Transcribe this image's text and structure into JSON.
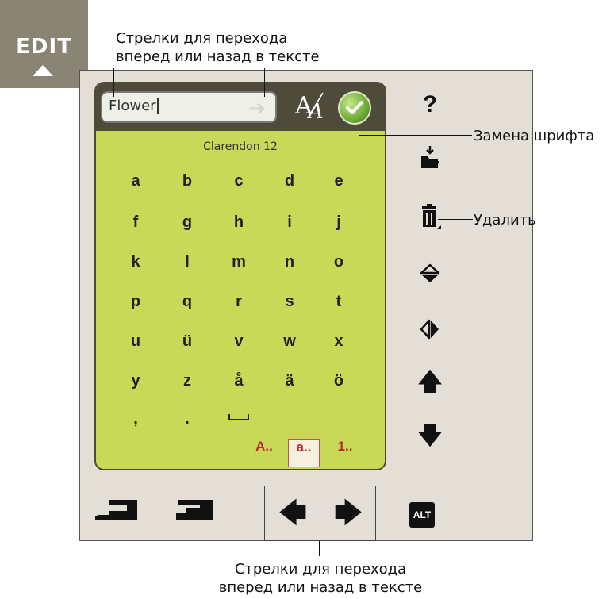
{
  "edit_button": {
    "label": "EDIT"
  },
  "keyboard": {
    "text_value": "Flower",
    "font_name": "Clarendon 12",
    "rows": [
      [
        "a",
        "b",
        "c",
        "d",
        "e"
      ],
      [
        "f",
        "g",
        "h",
        "i",
        "j"
      ],
      [
        "k",
        "l",
        "m",
        "n",
        "o"
      ],
      [
        "p",
        "q",
        "r",
        "s",
        "t"
      ],
      [
        "u",
        "ü",
        "v",
        "w",
        "x"
      ],
      [
        "y",
        "z",
        "å",
        "ä",
        "ö"
      ],
      [
        ",",
        ".",
        "␣"
      ]
    ],
    "modes": [
      "A..",
      "a..",
      "1.."
    ],
    "active_mode": "a..",
    "input_arrow_glyph": "➔"
  },
  "side_panel": {
    "help_label": "?",
    "move_up_glyph": "🡅",
    "move_down_glyph": "🡇"
  },
  "bottom": {
    "nav_left_glyph": "🡄",
    "nav_right_glyph": "🡆",
    "alt_label": "ALT"
  },
  "annotations": {
    "top_arrows": "Стрелки для перехода\nвперед или назад в тексте",
    "font_change": "Замена шрифта",
    "delete": "Удалить",
    "bottom_arrows": "Стрелки для перехода\nвперед или назад в тексте"
  },
  "colors": {
    "keyboard_bg": "#c7d957",
    "panel_bg": "#e4dfd6",
    "edit_bg": "#8a8474",
    "mode_text": "#c0232a"
  }
}
